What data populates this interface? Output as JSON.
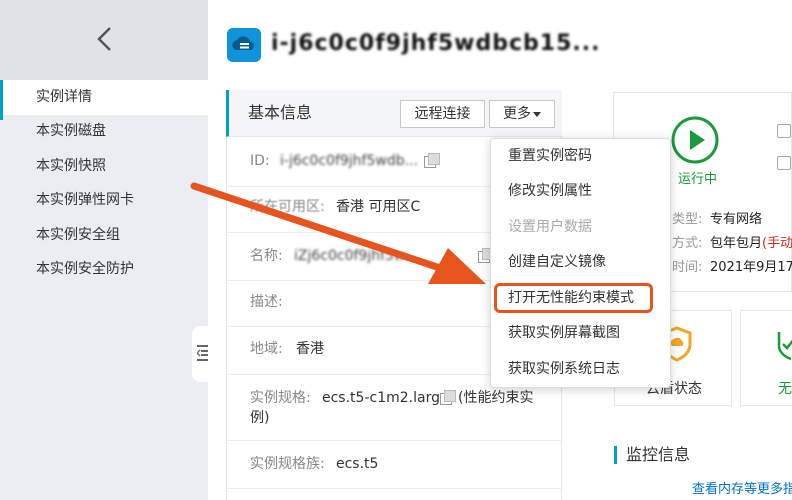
{
  "sidebar": {
    "back_icon": "chevron-left-icon",
    "items": [
      {
        "label": "实例详情",
        "active": true
      },
      {
        "label": "本实例磁盘"
      },
      {
        "label": "本实例快照"
      },
      {
        "label": "本实例弹性网卡"
      },
      {
        "label": "本实例安全组"
      },
      {
        "label": "本实例安全防护"
      }
    ]
  },
  "header": {
    "title": "i-j6c0c0f9jhf5wdbcb15...",
    "logo_icon": "ecs-cloud-icon"
  },
  "basic_info": {
    "title": "基本信息",
    "remote_connect": "远程连接",
    "more": "更多",
    "fields": [
      {
        "label": "ID:",
        "value": "i-j6c0c0f9jhf5wdb..."
      },
      {
        "label": "所在可用区:",
        "value": "香港 可用区C"
      },
      {
        "label": "名称:",
        "value": "iZj6c0c0f9jhf5w..."
      },
      {
        "label": "描述:",
        "value": ""
      },
      {
        "label": "地域:",
        "value": "香港"
      },
      {
        "label": "实例规格:",
        "value": "ecs.t5-c1m2.large",
        "extra": "(性能约束实例)"
      },
      {
        "label": "实例规格族:",
        "value": "ecs.t5"
      }
    ]
  },
  "more_menu": {
    "items": [
      {
        "label": "重置实例密码",
        "disabled": false
      },
      {
        "label": "修改实例属性",
        "disabled": false
      },
      {
        "label": "设置用户数据",
        "disabled": true
      },
      {
        "label": "创建自定义镜像",
        "disabled": false
      },
      {
        "label": "打开无性能约束模式",
        "disabled": false,
        "highlighted": true
      },
      {
        "label": "获取实例屏幕截图",
        "disabled": false
      },
      {
        "label": "获取实例系统日志",
        "disabled": false
      }
    ],
    "highlight_color": "#e8541e"
  },
  "status": {
    "running": "运行中",
    "running_color": "#1a9a3a",
    "rows": [
      {
        "label": "类型:",
        "value": "专有网络"
      },
      {
        "label": "方式:",
        "value": "包年包月",
        "extra": "(手动"
      },
      {
        "label": "时间:",
        "value": "2021年9月17"
      }
    ]
  },
  "cards": {
    "cloud_shield_label": "云盾状态",
    "right_label": "无"
  },
  "monitor": {
    "title": "监控信息",
    "link": "查看内存等更多指"
  },
  "colors": {
    "accent": "#00a2ca",
    "arrow": "#e8541e"
  }
}
